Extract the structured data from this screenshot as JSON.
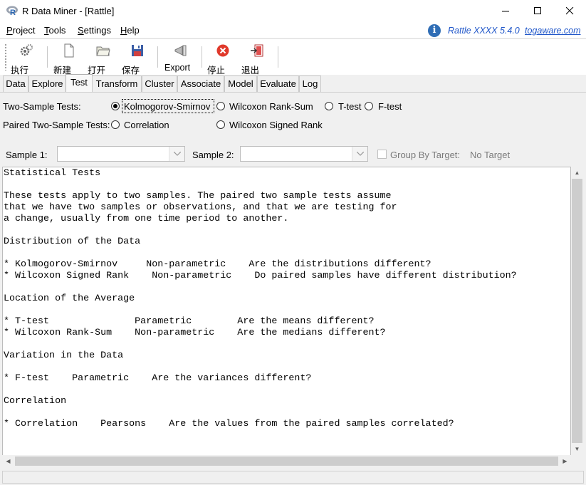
{
  "window": {
    "title": "R Data Miner - [Rattle]"
  },
  "menu": {
    "items": [
      {
        "first": "P",
        "rest": "roject"
      },
      {
        "first": "T",
        "rest": "ools"
      },
      {
        "first": "S",
        "rest": "ettings"
      },
      {
        "first": "H",
        "rest": "elp"
      }
    ],
    "version": "Rattle XXXX 5.4.0",
    "link": "togaware.com"
  },
  "toolbar": {
    "execute": "执行",
    "new": "新建",
    "open": "打开",
    "save": "保存",
    "export": "Export",
    "stop": "停止",
    "quit": "退出"
  },
  "tabs": [
    "Data",
    "Explore",
    "Test",
    "Transform",
    "Cluster",
    "Associate",
    "Model",
    "Evaluate",
    "Log"
  ],
  "active_tab": "Test",
  "tests": {
    "two_sample_label": "Two-Sample Tests:",
    "paired_label": "Paired Two-Sample Tests:",
    "options": {
      "ks": "Kolmogorov-Smirnov",
      "wrs": "Wilcoxon Rank-Sum",
      "ttest": "T-test",
      "ftest": "F-test",
      "corr": "Correlation",
      "wsr": "Wilcoxon Signed Rank"
    },
    "selected": "Kolmogorov-Smirnov"
  },
  "samples": {
    "sample1_label": "Sample 1:",
    "sample1_value": "",
    "sample2_label": "Sample 2:",
    "sample2_value": "",
    "group_by_label": "Group By Target:",
    "group_by_checked": false,
    "target_value": "No Target"
  },
  "output_lines": [
    "Statistical Tests",
    "",
    "These tests apply to two samples. The paired two sample tests assume",
    "that we have two samples or observations, and that we are testing for",
    "a change, usually from one time period to another.",
    "",
    "Distribution of the Data",
    "",
    "* Kolmogorov-Smirnov     Non-parametric    Are the distributions different?",
    "* Wilcoxon Signed Rank    Non-parametric    Do paired samples have different distribution?",
    "",
    "Location of the Average",
    "",
    "* T-test               Parametric        Are the means different?",
    "* Wilcoxon Rank-Sum    Non-parametric    Are the medians different?",
    "",
    "Variation in the Data",
    "",
    "* F-test    Parametric    Are the variances different?",
    "",
    "Correlation",
    "",
    "* Correlation    Pearsons    Are the values from the paired samples correlated?"
  ],
  "colors": {
    "link": "#1f56c9",
    "info": "#2f6db5",
    "stop": "#e0392b"
  }
}
